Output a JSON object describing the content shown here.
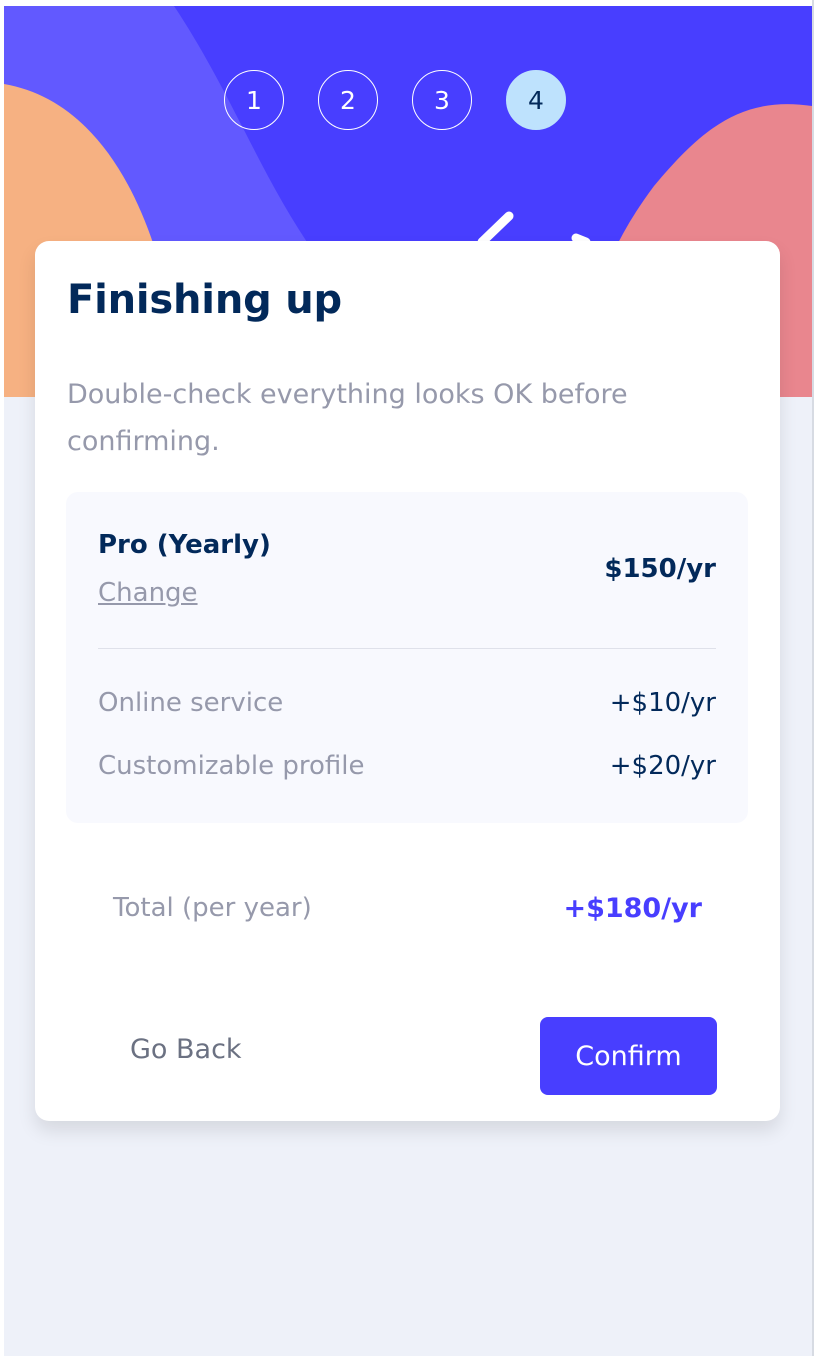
{
  "colors": {
    "brand": "#483eff",
    "navy": "#02295a",
    "muted": "#9699ab",
    "active_step": "#bee2fd"
  },
  "steps": [
    "1",
    "2",
    "3",
    "4"
  ],
  "active_step": "4",
  "card": {
    "title": "Finishing up",
    "subtitle": "Double-check everything looks OK before confirming."
  },
  "summary": {
    "plan_name": "Pro (Yearly)",
    "change_label": "Change",
    "plan_price": "$150/yr",
    "addons": [
      {
        "name": "Online service",
        "price": "+$10/yr"
      },
      {
        "name": "Customizable profile",
        "price": "+$20/yr"
      }
    ]
  },
  "total": {
    "label": "Total (per year)",
    "value": "+$180/yr"
  },
  "buttons": {
    "back_label": "Go Back",
    "confirm_label": "Confirm"
  }
}
